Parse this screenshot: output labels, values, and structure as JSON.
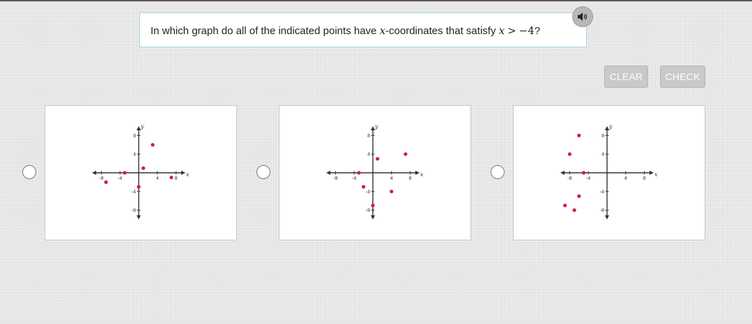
{
  "question": {
    "prefix": "In which graph do all of the indicated points have ",
    "var_x": "x",
    "suffix_coords": "-coordinates that satisfy ",
    "var_x2": "x",
    "op": ">",
    "num": "−4",
    "end": "?"
  },
  "buttons": {
    "clear_label": "CLEAR",
    "check_label": "CHECK"
  },
  "icons": {
    "audio": "speaker-icon"
  },
  "colors": {
    "point": "#cc2233",
    "axis": "#333333",
    "button_bg": "#c9c9c9",
    "question_border": "#a9d3e3"
  },
  "chart_data": [
    {
      "type": "scatter",
      "xlabel": "x",
      "ylabel": "y",
      "xlim": [
        -10,
        10
      ],
      "ylim": [
        -10,
        10
      ],
      "x_ticks": [
        "-8",
        "-4",
        "4",
        "8"
      ],
      "y_ticks": [
        "8",
        "4",
        "-4",
        "-8"
      ],
      "points": [
        {
          "x": -7,
          "y": -2
        },
        {
          "x": -3,
          "y": 0
        },
        {
          "x": 1,
          "y": 1
        },
        {
          "x": 3,
          "y": 6
        },
        {
          "x": 7,
          "y": -1
        },
        {
          "x": 0,
          "y": -3
        }
      ]
    },
    {
      "type": "scatter",
      "xlabel": "x",
      "ylabel": "y",
      "xlim": [
        -10,
        10
      ],
      "ylim": [
        -10,
        10
      ],
      "x_ticks": [
        "-8",
        "-4",
        "4",
        "8"
      ],
      "y_ticks": [
        "8",
        "4",
        "-4",
        "-8"
      ],
      "points": [
        {
          "x": -3,
          "y": 0
        },
        {
          "x": -2,
          "y": -3
        },
        {
          "x": 1,
          "y": 3
        },
        {
          "x": 7,
          "y": 4
        },
        {
          "x": 4,
          "y": -4
        },
        {
          "x": 0,
          "y": -7
        }
      ]
    },
    {
      "type": "scatter",
      "xlabel": "x",
      "ylabel": "y",
      "xlim": [
        -10,
        10
      ],
      "ylim": [
        -10,
        10
      ],
      "x_ticks": [
        "-8",
        "-4",
        "4",
        "8"
      ],
      "y_ticks": [
        "8",
        "4",
        "-4",
        "-8"
      ],
      "points": [
        {
          "x": -6,
          "y": 8
        },
        {
          "x": -8,
          "y": 4
        },
        {
          "x": -5,
          "y": 0
        },
        {
          "x": -6,
          "y": -5
        },
        {
          "x": -9,
          "y": -7
        },
        {
          "x": -7,
          "y": -8
        }
      ]
    }
  ]
}
